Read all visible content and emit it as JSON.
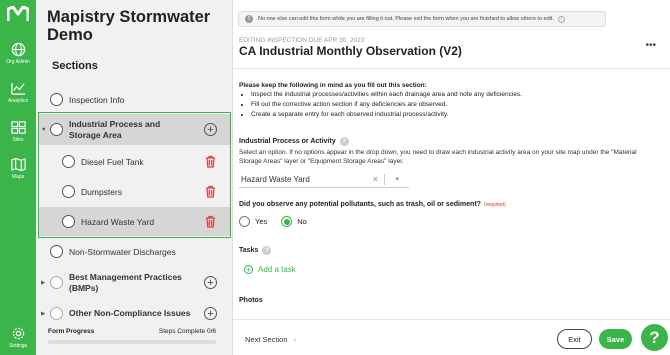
{
  "rail": {
    "items": [
      {
        "label": "Org Admin",
        "icon": "globe-icon"
      },
      {
        "label": "Analytics",
        "icon": "analytics-icon"
      },
      {
        "label": "Sites",
        "icon": "sites-icon"
      },
      {
        "label": "Maps",
        "icon": "map-icon"
      },
      {
        "label": "Settings",
        "icon": "gear-icon"
      }
    ]
  },
  "sidebar": {
    "app_title": "Mapistry Stormwater Demo",
    "sections_heading": "Sections",
    "items": [
      {
        "label": "Inspection Info"
      },
      {
        "label": "Industrial Process and Storage Area"
      },
      {
        "label": "Diesel Fuel Tank"
      },
      {
        "label": "Dumpsters"
      },
      {
        "label": "Hazard Waste Yard"
      },
      {
        "label": "Non-Stormwater Discharges"
      },
      {
        "label": "Best Management Practices (BMPs)"
      },
      {
        "label": "Other Non-Compliance Issues"
      }
    ],
    "progress_label": "Form Progress",
    "progress_steps": "Steps Complete 0/6",
    "progress_fraction": 0
  },
  "main": {
    "notice": "No one else can edit this form while you are filling it out. Please exit the form when you are finished to allow others to edit.",
    "kicker": "EDITING INSPECTION DUE APR 30, 2023",
    "title": "CA Industrial Monthly Observation (V2)",
    "more": "•••",
    "guide_title": "Please keep the following in mind as you fill out this section:",
    "guide_items": [
      "Inspect the industrial processes/activities within each drainage area and note any deficiencies.",
      "Fill out the corrective action section if any deficiencies are observed.",
      "Create a separate entry for each observed industrial process/activity."
    ],
    "field1_label": "Industrial Process or Activity",
    "field1_desc": "Select an option. If no options appear in the drop down, you need to draw each industrial activity area on your site map under the \"Material Storage Areas\" layer or \"Equipment Storage Areas\" layer.",
    "field1_value": "Hazard Waste Yard",
    "field2_label": "Did you observe any potential pollutants, such as trash, oil or sediment?",
    "field2_required": "(required)",
    "radio_yes": "Yes",
    "radio_no": "No",
    "tasks_label": "Tasks",
    "add_task": "Add a task",
    "photos_label": "Photos"
  },
  "footer": {
    "next_section": "Next Section",
    "exit": "Exit",
    "save": "Save",
    "help": "?"
  }
}
